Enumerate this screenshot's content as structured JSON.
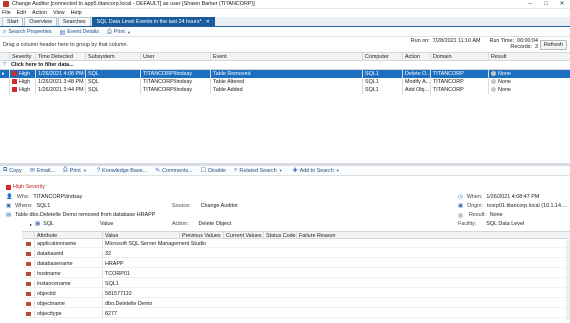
{
  "window": {
    "title": "Change Auditor [connected to app5.titancorp.local - DEFAULT] as user [Shawn Barker (TITANCORP)]",
    "min": "–",
    "max": "□",
    "close": "✕"
  },
  "menu": [
    "File",
    "Edit",
    "Action",
    "View",
    "Help"
  ],
  "tabs": [
    {
      "label": "Start",
      "active": false
    },
    {
      "label": "Overview",
      "active": false
    },
    {
      "label": "Searches",
      "active": false
    },
    {
      "label": "SQL Data Level Events in the last 24 hours*",
      "active": true
    }
  ],
  "tab_close": "✕",
  "toolbar": {
    "search_properties": "Search Properties",
    "event_details": "Event Details",
    "print": "Print"
  },
  "runinfo": {
    "run_on_label": "Run on:",
    "run_on_value": "7/28/2021 11:10 AM",
    "run_time_label": "Run Time:",
    "run_time_value": "00:00:04",
    "records_label": "Records:",
    "records_value": "3",
    "refresh": "Refresh"
  },
  "grid": {
    "group_hint": "Drag a column header here to group by that column.",
    "filter_hint": "Click here to filter data...",
    "columns": [
      "Severity",
      "Time Detected",
      "Subsystem",
      "User",
      "Event",
      "Computer",
      "Action",
      "Domain",
      "Result"
    ],
    "rows": [
      {
        "severity": "High",
        "time": "1/26/2021 4:08 PM",
        "subsystem": "SQL",
        "user": "TITANCORP\\lindsay",
        "event": "Table Removed",
        "computer": "SQL1",
        "action": "Delete O...",
        "domain": "TITANCORP",
        "result": "None",
        "selected": true
      },
      {
        "severity": "High",
        "time": "1/26/2021 3:48 PM",
        "subsystem": "SQL",
        "user": "TITANCORP\\lindsay",
        "event": "Table Altered",
        "computer": "SQL1",
        "action": "Modify A...",
        "domain": "TITANCORP",
        "result": "None",
        "selected": false
      },
      {
        "severity": "High",
        "time": "1/26/2021 3:44 PM",
        "subsystem": "SQL",
        "user": "TITANCORP\\lindsay",
        "event": "Table Added",
        "computer": "SQL1",
        "action": "Add Obj...",
        "domain": "TITANCORP",
        "result": "None",
        "selected": false
      }
    ]
  },
  "details_toolbar": {
    "copy": "Copy",
    "email": "Email...",
    "print": "Print",
    "knowledge_base": "Knowledge Base...",
    "comments": "Comments...",
    "disable": "Disable",
    "related_search": "Related Search",
    "add_to_search": "Add to Search"
  },
  "details": {
    "severity": "High Severity",
    "who_label": "Who:",
    "who_value": "TITANCORP\\lindsay",
    "where_label": "Where:",
    "where_value": "SQL1",
    "source_label": "Source:",
    "source_value": "Change Auditor",
    "what_value": "Table dbo.Deletelle Demo removed from database HRAPP",
    "action_label": "Action:",
    "action_value": "Delete Object",
    "when_label": "When:",
    "when_value": "1/26/2021 4:08:47 PM",
    "origin_label": "Origin:",
    "origin_value": "tcorp01.titancorp.local (10.1.14....",
    "result_label": "Result:",
    "result_value": "None",
    "facility_label": "Facility:",
    "facility_value": "SQL Data Level",
    "sql_group": "SQL",
    "value_group": "Value"
  },
  "attributes": {
    "columns": [
      "Attribute",
      "Value",
      "Previous Values",
      "Current Values",
      "Status Code",
      "Failure Reason"
    ],
    "rows": [
      {
        "attribute": "applicationname",
        "value": "Microsoft SQL Server Management Studio"
      },
      {
        "attribute": "databaseid",
        "value": "32"
      },
      {
        "attribute": "databasename",
        "value": "HRAPP"
      },
      {
        "attribute": "hostname",
        "value": "TCORP01"
      },
      {
        "attribute": "instancename",
        "value": "SQL1"
      },
      {
        "attribute": "objectid",
        "value": "581577110"
      },
      {
        "attribute": "objectname",
        "value": "dbo.Deletelle Demo"
      },
      {
        "attribute": "objecttype",
        "value": "8277"
      }
    ]
  }
}
